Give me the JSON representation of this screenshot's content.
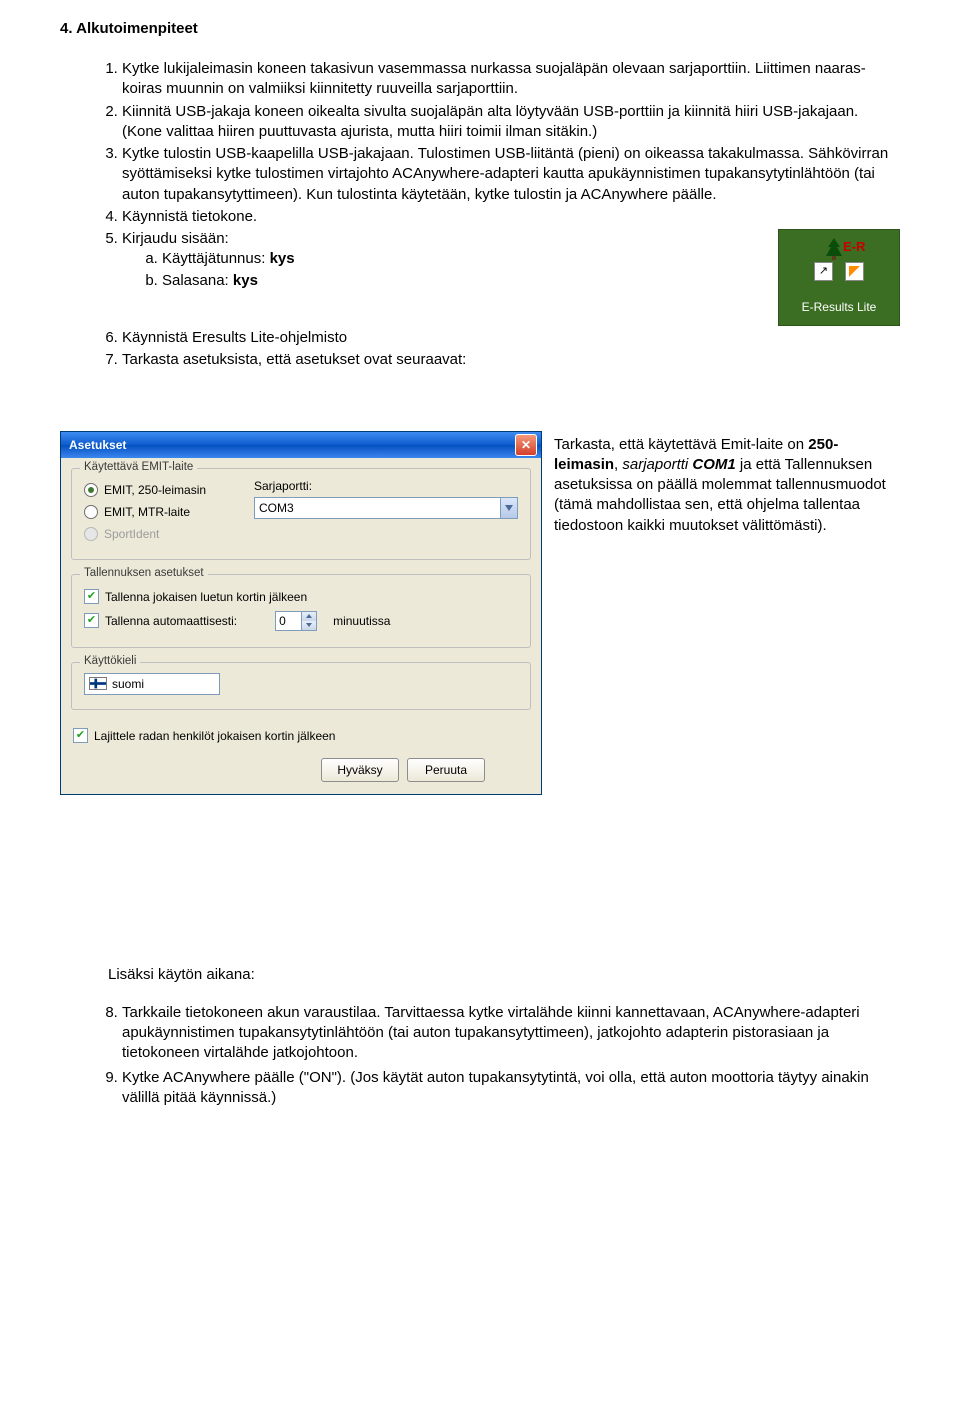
{
  "doc": {
    "heading": "4. Alkutoimenpiteet",
    "list": {
      "i1": "Kytke lukijaleimasin koneen takasivun vasemmassa nurkassa suojaläpän olevaan sarjaporttiin. Liittimen naaras-koiras muunnin on valmiiksi kiinnitetty ruuveilla sarjaporttiin.",
      "i2": "Kiinnitä USB-jakaja koneen oikealta sivulta suojaläpän alta löytyvään USB-porttiin ja kiinnitä hiiri USB-jakajaan. (Kone valittaa hiiren puuttuvasta ajurista, mutta hiiri toimii ilman sitäkin.)",
      "i3": "Kytke tulostin USB-kaapelilla USB-jakajaan. Tulostimen USB-liitäntä (pieni) on oikeassa takakulmassa. Sähkövirran syöttämiseksi kytke tulostimen virtajohto ACAnywhere-adapteri kautta apukäynnistimen tupakansytytinlähtöön (tai auton tupakansytyttimeen). Kun tulostinta käytetään, kytke tulostin ja ACAnywhere päälle.",
      "i4": "Käynnistä tietokone.",
      "i5": "Kirjaudu sisään:",
      "i5a_pre": "Käyttäjätunnus: ",
      "i5a_b": "kys",
      "i5b_pre": "Salasana: ",
      "i5b_b": "kys",
      "i6": "Käynnistä Eresults Lite-ohjelmisto",
      "i7": "Tarkasta asetuksista, että asetukset ovat seuraavat:"
    },
    "desktop_icon": {
      "er": "E-R",
      "label": "E-Results Lite"
    },
    "dialog": {
      "title": "Asetukset",
      "g1": {
        "title": "Käytettävä EMIT-laite",
        "r1": "EMIT, 250-leimasin",
        "r2": "EMIT, MTR-laite",
        "r3": "SportIdent",
        "port_lbl": "Sarjaportti:",
        "port_val": "COM3"
      },
      "g2": {
        "title": "Tallennuksen asetukset",
        "c1": "Tallenna jokaisen luetun kortin jälkeen",
        "c2": "Tallenna automaattisesti:",
        "num": "0",
        "min": "minuutissa"
      },
      "g3": {
        "title": "Käyttökieli",
        "val": "suomi"
      },
      "c_last": "Lajittele radan henkilöt jokaisen kortin jälkeen",
      "ok": "Hyväksy",
      "cancel": "Peruuta"
    },
    "sidebar_html_parts": {
      "p0": "Tarkasta, että käytettävä Emit-laite on ",
      "p1": "250-leimasin",
      "p2": ", ",
      "p3": "sarjaportti",
      "p4": " ",
      "p5": "COM1",
      "p6": " ja että Tallennuksen asetuksissa on päällä molemmat tallennusmuodot (tämä mahdollistaa sen, että ohjelma tallentaa tiedostoon kaikki muutokset välittömästi)."
    },
    "extra": {
      "lead": "Lisäksi käytön aikana:",
      "i8": "Tarkkaile tietokoneen akun varaustilaa. Tarvittaessa kytke virtalähde kiinni kannettavaan, ACAnywhere-adapteri apukäynnistimen tupakansytytinlähtöön (tai auton tupakansytyttimeen), jatkojohto adapterin pistorasiaan ja tietokoneen virtalähde jatkojohtoon.",
      "i9": "Kytke ACAnywhere päälle (\"ON\"). (Jos käytät auton tupakansytytintä, voi olla, että auton moottoria täytyy ainakin välillä pitää käynnissä.)"
    }
  }
}
